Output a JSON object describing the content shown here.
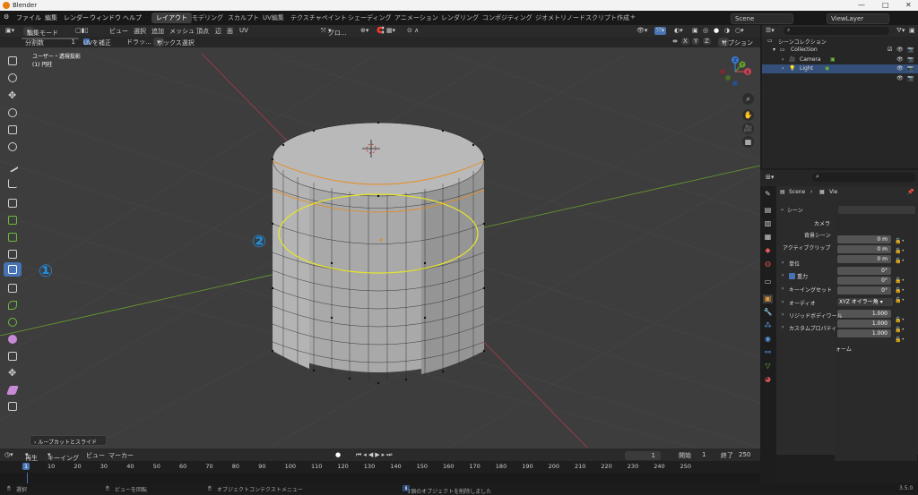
{
  "window": {
    "title": "Blender"
  },
  "menubar": {
    "menus": [
      "ファイル",
      "編集",
      "レンダー",
      "ウィンドウ",
      "ヘルプ"
    ],
    "workspaces": [
      "レイアウト",
      "モデリング",
      "スカルプト",
      "UV編集",
      "テクスチャペイント",
      "シェーディング",
      "アニメーション",
      "レンダリング",
      "コンポジティング",
      "ジオメトリノード",
      "スクリプト作成"
    ],
    "add_tab": "+",
    "scene": "Scene",
    "view_layer": "ViewLayer"
  },
  "viewport_header": {
    "mode": "編集モード",
    "menus": [
      "ビュー",
      "選択",
      "追加",
      "メッシュ",
      "頂点",
      "辺",
      "面",
      "UV"
    ],
    "orientation": "グロ...",
    "xyz": [
      "X",
      "Y",
      "Z"
    ],
    "options": "オプション"
  },
  "tool_header": {
    "cuts_label": "分割数",
    "cuts_value": "1",
    "uv_correct": "UVを補正",
    "drag_label": "ドラッ...",
    "box_select": "ボックス選択"
  },
  "viewport": {
    "overlay_line1": "ユーザー・透視投影",
    "overlay_line2": "(1) 円柱",
    "last_operator": "ループカットとスライド",
    "callout1": "①",
    "callout2": "②"
  },
  "gizmo": {
    "x": "X",
    "y": "Y",
    "z": "Z"
  },
  "timeline": {
    "menus": [
      "再生",
      "キーイング",
      "ビュー",
      "マーカー"
    ],
    "current_frame": "1",
    "start_label": "開始",
    "start_value": "1",
    "end_label": "終了",
    "end_value": "250",
    "ticks": [
      "1",
      "10",
      "20",
      "30",
      "40",
      "50",
      "60",
      "70",
      "80",
      "90",
      "100",
      "110",
      "120",
      "130",
      "140",
      "150",
      "160",
      "170",
      "180",
      "190",
      "200",
      "210",
      "220",
      "230",
      "240",
      "250"
    ]
  },
  "statusbar": {
    "select": "選択",
    "rotate": "ビューを回転",
    "context": "オブジェクトコンテクストメニュー",
    "notice": "1個のオブジェクトを削除しました",
    "version": "3.5.0"
  },
  "outliner": {
    "root": "シーンコレクション",
    "collection": "Collection",
    "items": [
      "Camera",
      "Light"
    ]
  },
  "properties": {
    "breadcrumb_scene": "Scene",
    "breadcrumb_view": "Vie",
    "section_scene": "シーン",
    "camera_label": "カメラ",
    "background_label": "背景シーン",
    "active_clip_label": "アクティブクリップ",
    "units": "単位",
    "gravity": "重力",
    "keying_set": "キーイングセット",
    "audio": "オーディオ",
    "rigid_body": "リジッドボディワール",
    "custom_props": "カスタムプロパティ",
    "values": [
      "0 m",
      "0 m",
      "0 m",
      "0°",
      "0°",
      "0°"
    ],
    "rotation_mode": "XYZ オイラー角",
    "scale": [
      "1.000",
      "1.000",
      "1.000"
    ],
    "transform_tail": "ォーム"
  }
}
